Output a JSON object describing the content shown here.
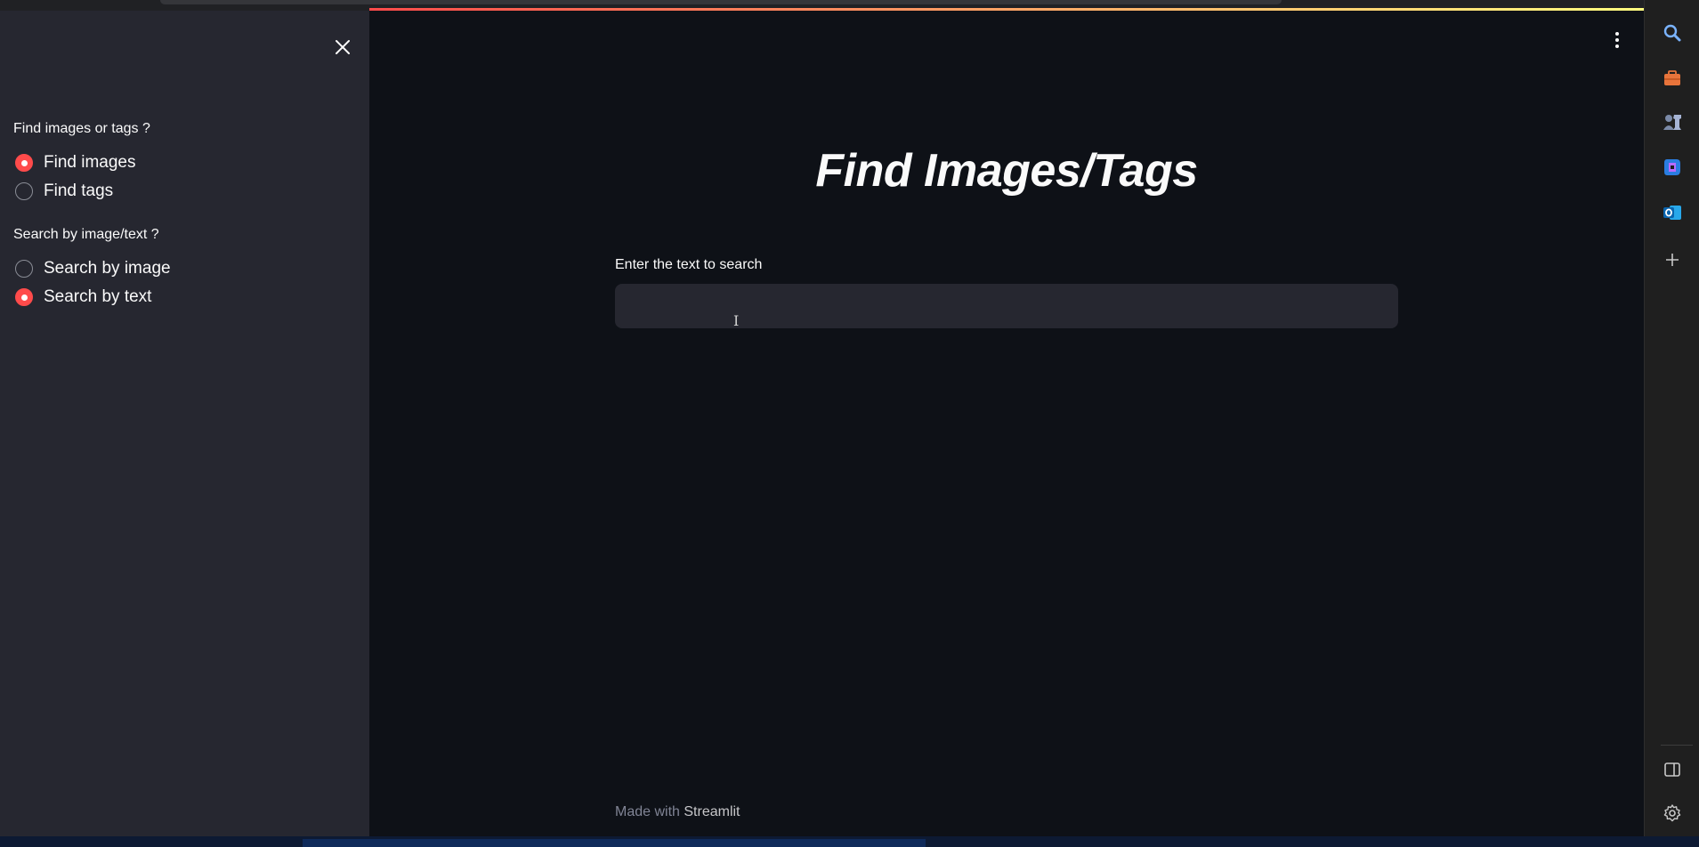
{
  "sidebar": {
    "group1": {
      "label": "Find images or tags ?",
      "options": [
        {
          "label": "Find images",
          "checked": true
        },
        {
          "label": "Find tags",
          "checked": false
        }
      ]
    },
    "group2": {
      "label": "Search by image/text ?",
      "options": [
        {
          "label": "Search by image",
          "checked": false
        },
        {
          "label": "Search by text",
          "checked": true
        }
      ]
    }
  },
  "main": {
    "title": "Find Images/Tags",
    "input_label": "Enter the text to search",
    "input_value": "",
    "footer_prefix": "Made with ",
    "footer_brand": "Streamlit"
  },
  "edge_sidebar": {
    "icons": [
      "search-icon",
      "briefcase-icon",
      "chess-icon",
      "copilot-icon",
      "outlook-icon",
      "plus-icon",
      "sidebar-toggle-icon",
      "settings-icon"
    ]
  },
  "colors": {
    "accent": "#ff4b4b",
    "background": "#0e1117",
    "sidebar": "#262730",
    "text": "#fafafa"
  }
}
